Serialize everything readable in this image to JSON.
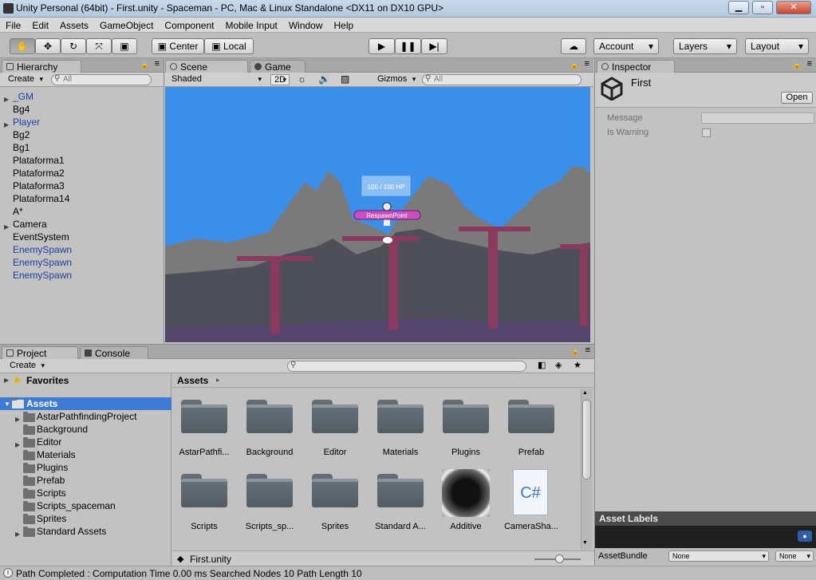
{
  "window": {
    "title": "Unity Personal (64bit) - First.unity - Spaceman - PC, Mac & Linux Standalone <DX11 on DX10 GPU>"
  },
  "menu": [
    "File",
    "Edit",
    "Assets",
    "GameObject",
    "Component",
    "Mobile Input",
    "Window",
    "Help"
  ],
  "toolbar": {
    "pivot_label": "Center",
    "space_label": "Local",
    "account_label": "Account",
    "layers_label": "Layers",
    "layout_label": "Layout"
  },
  "hierarchy": {
    "tab_label": "Hierarchy",
    "create_label": "Create",
    "search_placeholder": "All",
    "items": [
      {
        "label": "_GM",
        "prefab": true,
        "expandable": true
      },
      {
        "label": "Bg4",
        "prefab": false,
        "expandable": false
      },
      {
        "label": "Player",
        "prefab": true,
        "expandable": true
      },
      {
        "label": "Bg2",
        "prefab": false,
        "expandable": false
      },
      {
        "label": "Bg1",
        "prefab": false,
        "expandable": false
      },
      {
        "label": "Plataforma1",
        "prefab": false,
        "expandable": false
      },
      {
        "label": "Plataforma2",
        "prefab": false,
        "expandable": false
      },
      {
        "label": "Plataforma3",
        "prefab": false,
        "expandable": false
      },
      {
        "label": "Plataforma14",
        "prefab": false,
        "expandable": false
      },
      {
        "label": "A*",
        "prefab": false,
        "expandable": false
      },
      {
        "label": "Camera",
        "prefab": false,
        "expandable": true
      },
      {
        "label": "EventSystem",
        "prefab": false,
        "expandable": false
      },
      {
        "label": "EnemySpawn",
        "prefab": true,
        "expandable": false
      },
      {
        "label": "EnemySpawn",
        "prefab": true,
        "expandable": false
      },
      {
        "label": "EnemySpawn",
        "prefab": true,
        "expandable": false
      }
    ]
  },
  "scene": {
    "tab_scene": "Scene",
    "tab_game": "Game",
    "shading_mode": "Shaded",
    "mode_2d": "2D",
    "gizmos_label": "Gizmos",
    "search_placeholder": "All",
    "hp_text": "100 / 100 HP",
    "respawn_label": "RespawnPoint",
    "sky_color": "#3b8fe8"
  },
  "inspector": {
    "tab_label": "Inspector",
    "object_name": "First",
    "open_label": "Open",
    "fields": [
      {
        "label": "Message",
        "type": "text",
        "value": ""
      },
      {
        "label": "Is Warning",
        "type": "checkbox",
        "value": false
      }
    ],
    "asset_labels_title": "Asset Labels",
    "asset_bundle_label": "AssetBundle",
    "asset_bundle_value": "None",
    "asset_bundle_variant": "None"
  },
  "project": {
    "tab_project": "Project",
    "tab_console": "Console",
    "create_label": "Create",
    "favorites_label": "Favorites",
    "assets_root": "Assets",
    "breadcrumb": "Assets",
    "tree": [
      {
        "label": "AstarPathfindingProject",
        "expandable": true
      },
      {
        "label": "Background",
        "expandable": false
      },
      {
        "label": "Editor",
        "expandable": true
      },
      {
        "label": "Materials",
        "expandable": false
      },
      {
        "label": "Plugins",
        "expandable": false
      },
      {
        "label": "Prefab",
        "expandable": false
      },
      {
        "label": "Scripts",
        "expandable": false
      },
      {
        "label": "Scripts_spaceman",
        "expandable": false
      },
      {
        "label": "Sprites",
        "expandable": false
      },
      {
        "label": "Standard Assets",
        "expandable": true
      }
    ],
    "grid": [
      {
        "label": "AstarPathfi...",
        "kind": "folder"
      },
      {
        "label": "Background",
        "kind": "folder"
      },
      {
        "label": "Editor",
        "kind": "folder"
      },
      {
        "label": "Materials",
        "kind": "folder"
      },
      {
        "label": "Plugins",
        "kind": "folder"
      },
      {
        "label": "Prefab",
        "kind": "folder"
      },
      {
        "label": "Scripts",
        "kind": "folder"
      },
      {
        "label": "Scripts_sp...",
        "kind": "folder"
      },
      {
        "label": "Sprites",
        "kind": "folder"
      },
      {
        "label": "Standard A...",
        "kind": "folder"
      },
      {
        "label": "Additive",
        "kind": "material"
      },
      {
        "label": "CameraSha...",
        "kind": "script"
      }
    ],
    "selected_file": "First.unity",
    "script_glyph": "C#"
  },
  "status": {
    "message": "Path Completed : Computation Time 0.00 ms Searched Nodes 10 Path Length 10"
  }
}
